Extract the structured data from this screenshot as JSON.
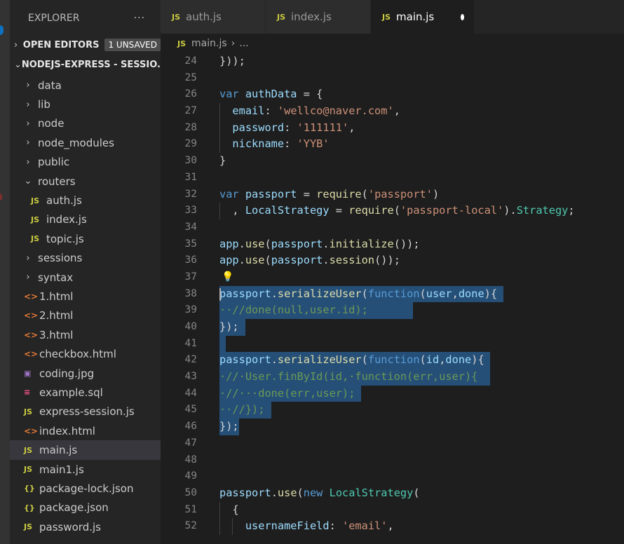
{
  "explorer": {
    "title": "EXPLORER",
    "more": "···",
    "open_editors_label": "OPEN EDITORS",
    "unsaved_badge": "1 UNSAVED",
    "project_label": "NODEJS-EXPRESS - SESSIO..."
  },
  "tree": [
    {
      "label": "data",
      "chev": "›",
      "indent": 18
    },
    {
      "label": "lib",
      "chev": "›",
      "indent": 18
    },
    {
      "label": "node",
      "chev": "›",
      "indent": 18
    },
    {
      "label": "node_modules",
      "chev": "›",
      "indent": 18
    },
    {
      "label": "public",
      "chev": "›",
      "indent": 18
    },
    {
      "label": "routers",
      "chev": "⌄",
      "indent": 18
    },
    {
      "label": "auth.js",
      "icon": "js",
      "indent": 30
    },
    {
      "label": "index.js",
      "icon": "js",
      "indent": 30
    },
    {
      "label": "topic.js",
      "icon": "js",
      "indent": 30
    },
    {
      "label": "sessions",
      "chev": "›",
      "indent": 18
    },
    {
      "label": "syntax",
      "chev": "›",
      "indent": 18
    },
    {
      "label": "1.html",
      "icon": "html",
      "indent": 20
    },
    {
      "label": "2.html",
      "icon": "html",
      "indent": 20
    },
    {
      "label": "3.html",
      "icon": "html",
      "indent": 20
    },
    {
      "label": "checkbox.html",
      "icon": "html",
      "indent": 20
    },
    {
      "label": "coding.jpg",
      "icon": "img",
      "indent": 20
    },
    {
      "label": "example.sql",
      "icon": "sql",
      "indent": 20
    },
    {
      "label": "express-session.js",
      "icon": "js",
      "indent": 20
    },
    {
      "label": "index.html",
      "icon": "html",
      "indent": 20
    },
    {
      "label": "main.js",
      "icon": "js",
      "indent": 20,
      "active": true
    },
    {
      "label": "main1.js",
      "icon": "js",
      "indent": 20
    },
    {
      "label": "package-lock.json",
      "icon": "json",
      "indent": 20
    },
    {
      "label": "package.json",
      "icon": "json",
      "indent": 20
    },
    {
      "label": "password.js",
      "icon": "js",
      "indent": 20
    }
  ],
  "tabs": [
    {
      "label": "auth.js",
      "icon": "JS",
      "width": 150
    },
    {
      "label": "index.js",
      "icon": "JS",
      "width": 150
    },
    {
      "label": "main.js",
      "icon": "JS",
      "width": 148,
      "active": true,
      "dirty": true
    }
  ],
  "breadcrumb": {
    "icon": "JS",
    "file": "main.js",
    "sep": "›",
    "rest": "..."
  },
  "code_lines": [
    {
      "n": "24",
      "t": [
        [
          "}));",
          "pn"
        ]
      ]
    },
    {
      "n": "25",
      "t": []
    },
    {
      "n": "26",
      "t": [
        [
          "var ",
          "kw"
        ],
        [
          "authData",
          "id"
        ],
        [
          " = {",
          "pn"
        ]
      ]
    },
    {
      "n": "27",
      "t": [
        [
          "  ",
          "pn"
        ],
        [
          "email",
          "id"
        ],
        [
          ": ",
          "pn"
        ],
        [
          "'wellco@naver.com'",
          "st"
        ],
        [
          ",",
          "pn"
        ]
      ],
      "g": [
        1
      ]
    },
    {
      "n": "28",
      "t": [
        [
          "  ",
          "pn"
        ],
        [
          "password",
          "id"
        ],
        [
          ": ",
          "pn"
        ],
        [
          "'111111'",
          "st"
        ],
        [
          ",",
          "pn"
        ]
      ],
      "g": [
        1
      ]
    },
    {
      "n": "29",
      "t": [
        [
          "  ",
          "pn"
        ],
        [
          "nickname",
          "id"
        ],
        [
          ": ",
          "pn"
        ],
        [
          "'YYB'",
          "st"
        ]
      ],
      "g": [
        1
      ]
    },
    {
      "n": "30",
      "t": [
        [
          "}",
          "pn"
        ]
      ]
    },
    {
      "n": "31",
      "t": []
    },
    {
      "n": "32",
      "t": [
        [
          "var ",
          "kw"
        ],
        [
          "passport",
          "id"
        ],
        [
          " = ",
          "pn"
        ],
        [
          "require",
          "fn"
        ],
        [
          "(",
          "pn"
        ],
        [
          "'passport'",
          "st"
        ],
        [
          ")",
          "pn"
        ]
      ]
    },
    {
      "n": "33",
      "t": [
        [
          "  , ",
          "pn"
        ],
        [
          "LocalStrategy",
          "id"
        ],
        [
          " = ",
          "pn"
        ],
        [
          "require",
          "fn"
        ],
        [
          "(",
          "pn"
        ],
        [
          "'passport-local'",
          "st"
        ],
        [
          ").",
          "pn"
        ],
        [
          "Strategy",
          "cls"
        ],
        [
          ";",
          "pn"
        ]
      ],
      "g": [
        1
      ]
    },
    {
      "n": "34",
      "t": []
    },
    {
      "n": "35",
      "t": [
        [
          "app",
          "id"
        ],
        [
          ".",
          "pn"
        ],
        [
          "use",
          "fn"
        ],
        [
          "(",
          "pn"
        ],
        [
          "passport",
          "id"
        ],
        [
          ".",
          "pn"
        ],
        [
          "initialize",
          "fn"
        ],
        [
          "());",
          "pn"
        ]
      ]
    },
    {
      "n": "36",
      "t": [
        [
          "app",
          "id"
        ],
        [
          ".",
          "pn"
        ],
        [
          "use",
          "fn"
        ],
        [
          "(",
          "pn"
        ],
        [
          "passport",
          "id"
        ],
        [
          ".",
          "pn"
        ],
        [
          "session",
          "fn"
        ],
        [
          "());",
          "pn"
        ]
      ]
    },
    {
      "n": "37",
      "t": [],
      "bulb": true
    },
    {
      "n": "38",
      "t": [
        [
          "passport",
          "id"
        ],
        [
          ".",
          "pn"
        ],
        [
          "serializeUser",
          "fn"
        ],
        [
          "(",
          "pn"
        ],
        [
          "function",
          "kw"
        ],
        [
          "(",
          "pn"
        ],
        [
          "user",
          "id"
        ],
        [
          ",",
          "pn"
        ],
        [
          "done",
          "id"
        ],
        [
          "){",
          "pn"
        ]
      ],
      "sel": 44,
      "cursor": true
    },
    {
      "n": "39",
      "t": [
        [
          "··",
          "cm"
        ],
        [
          "//done(null,user.id);",
          "cm"
        ]
      ],
      "sel": 30
    },
    {
      "n": "40",
      "t": [
        [
          "});",
          "pn"
        ]
      ],
      "sel": 4
    },
    {
      "n": "41",
      "t": [],
      "sel": 1
    },
    {
      "n": "42",
      "t": [
        [
          "passport",
          "id"
        ],
        [
          ".",
          "pn"
        ],
        [
          "serializeUser",
          "fn"
        ],
        [
          "(",
          "pn"
        ],
        [
          "function",
          "kw"
        ],
        [
          "(",
          "pn"
        ],
        [
          "id",
          "id"
        ],
        [
          ",",
          "pn"
        ],
        [
          "done",
          "id"
        ],
        [
          "){",
          "pn"
        ]
      ],
      "sel": 42
    },
    {
      "n": "43",
      "t": [
        [
          "·",
          "cm"
        ],
        [
          "//·User.finById(id,·function(err,user){",
          "cm"
        ]
      ],
      "sel": 42
    },
    {
      "n": "44",
      "t": [
        [
          "·",
          "cm"
        ],
        [
          "//···done(err,user);",
          "cm"
        ]
      ],
      "sel": 22
    },
    {
      "n": "45",
      "t": [
        [
          "·",
          "cm"
        ],
        [
          "·//});",
          "cm"
        ]
      ],
      "sel": 8
    },
    {
      "n": "46",
      "t": [
        [
          "});",
          "pn"
        ]
      ],
      "sel": 3
    },
    {
      "n": "47",
      "t": []
    },
    {
      "n": "48",
      "t": []
    },
    {
      "n": "49",
      "t": []
    },
    {
      "n": "50",
      "t": [
        [
          "passport",
          "id"
        ],
        [
          ".",
          "pn"
        ],
        [
          "use",
          "fn"
        ],
        [
          "(",
          "pn"
        ],
        [
          "new ",
          "kw"
        ],
        [
          "LocalStrategy",
          "cls"
        ],
        [
          "(",
          "pn"
        ]
      ]
    },
    {
      "n": "51",
      "t": [
        [
          "  {",
          "pn"
        ]
      ],
      "g": [
        1
      ]
    },
    {
      "n": "52",
      "t": [
        [
          "    ",
          "pn"
        ],
        [
          "usernameField",
          "id"
        ],
        [
          ": ",
          "pn"
        ],
        [
          "'email'",
          "st"
        ],
        [
          ",",
          "pn"
        ]
      ],
      "g": [
        1,
        2
      ]
    }
  ]
}
